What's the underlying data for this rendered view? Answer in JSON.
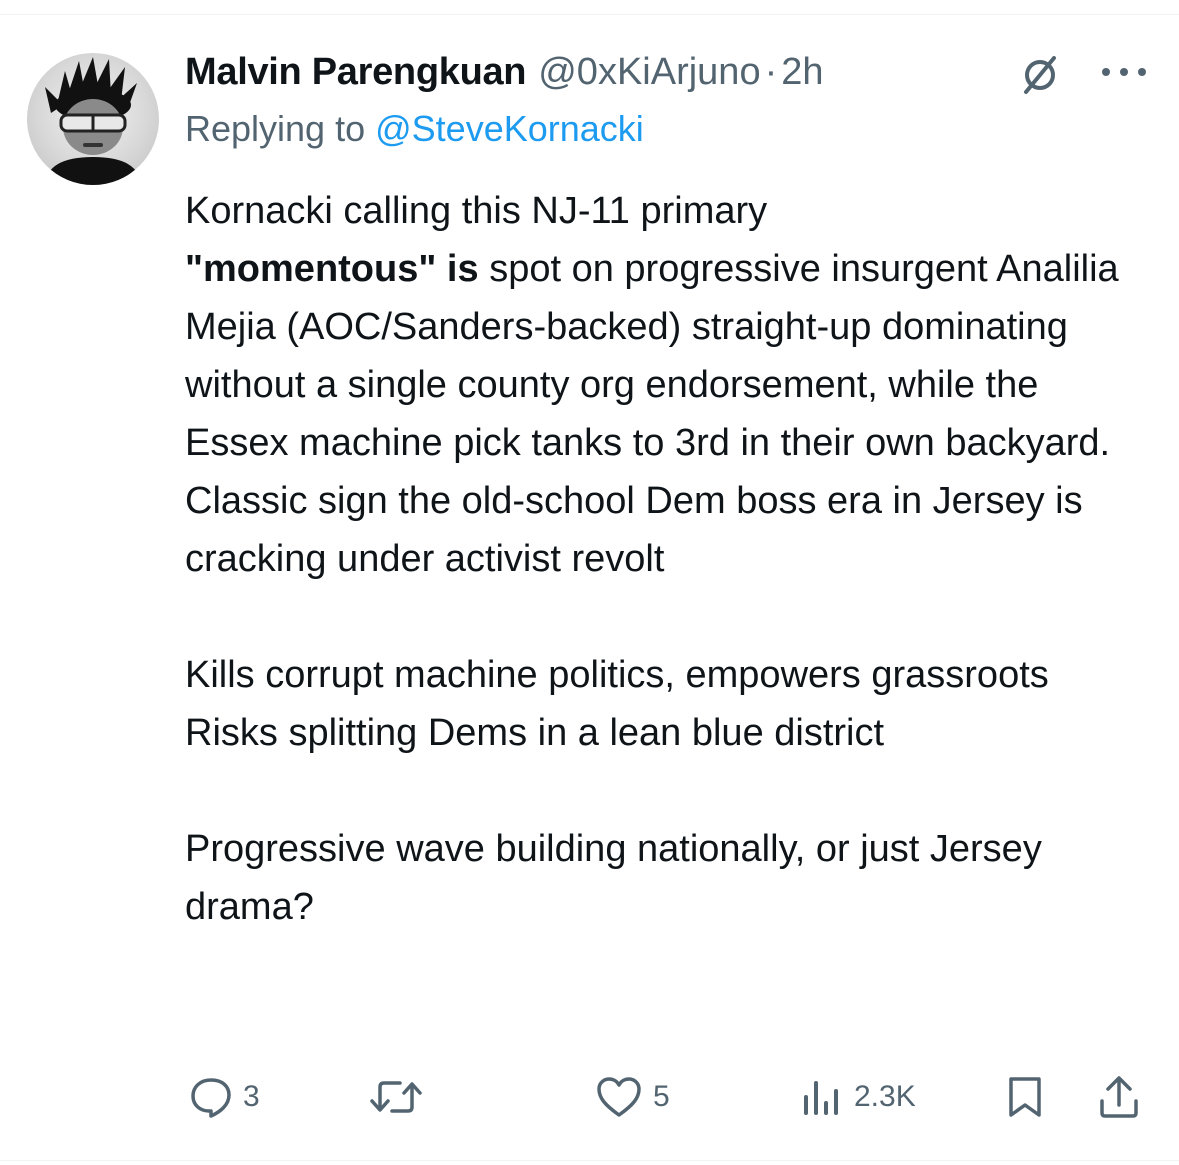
{
  "post": {
    "author_name": "Malvin Parengkuan",
    "handle": "@0xKiArjuno",
    "separator": "·",
    "time": "2h",
    "replying_prefix": "Replying to ",
    "replying_to": "@SteveKornacki",
    "avatar_icon": "avatar-photo",
    "grok_icon": "grok-icon",
    "more_icon": "more-icon",
    "body": {
      "p1_start": "Kornacki calling this NJ-11 primary",
      "p1_bold": "\"momentous\" is",
      "p1_rest": " spot on progressive insurgent Analilia Mejia (AOC/Sanders-backed) straight-up dominating without a single county org endorsement, while the Essex machine pick tanks to 3rd in their own backyard. Classic sign the old-school Dem boss era in Jersey is cracking under activist revolt",
      "line_2a": "Kills corrupt machine politics, empowers grassroots",
      "line_2b": "Risks splitting Dems in a lean blue district",
      "line_3": "Progressive wave building nationally, or just Jersey drama?"
    }
  },
  "actions": {
    "reply_count": "3",
    "retweet_count": "",
    "like_count": "5",
    "views_count": "2.3K",
    "icons": [
      "reply-icon",
      "retweet-icon",
      "like-icon",
      "views-icon",
      "bookmark-icon",
      "share-icon"
    ]
  },
  "colors": {
    "text": "#0f1419",
    "secondary": "#536471",
    "link": "#1d9bf0",
    "divider": "#eff3f4"
  }
}
